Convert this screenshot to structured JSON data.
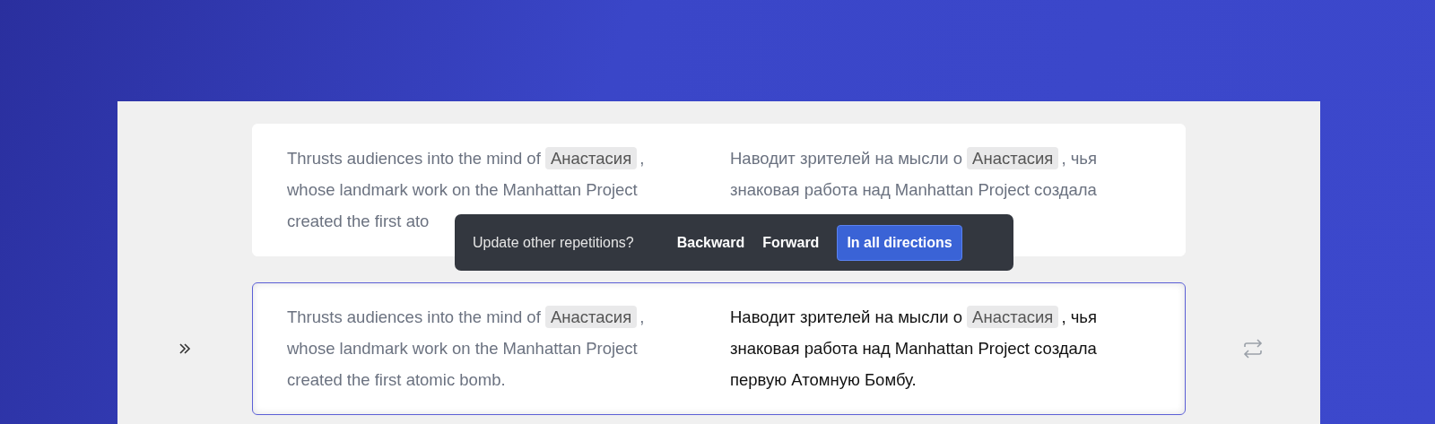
{
  "segments": [
    {
      "current": false,
      "source": [
        [
          {
            "kind": "text",
            "text": "Thrusts audiences into the mind of "
          },
          {
            "kind": "tag",
            "text": "Анастасия"
          },
          {
            "kind": "text",
            "text": ","
          }
        ],
        [
          {
            "kind": "text",
            "text": "whose landmark work on the Manhattan Project"
          }
        ],
        [
          {
            "kind": "text",
            "text": "created the first ato"
          }
        ]
      ],
      "target": [
        [
          {
            "kind": "text",
            "text": "Наводит зрителей на мысли о "
          },
          {
            "kind": "tag",
            "text": "Анастасия"
          },
          {
            "kind": "text",
            "text": ", чья"
          }
        ],
        [
          {
            "kind": "text",
            "text": "знаковая работа над Manhattan Project создала"
          }
        ]
      ]
    },
    {
      "current": true,
      "source": [
        [
          {
            "kind": "text",
            "text": "Thrusts audiences into the mind of "
          },
          {
            "kind": "tag",
            "text": "Анастасия"
          },
          {
            "kind": "text",
            "text": ","
          }
        ],
        [
          {
            "kind": "text",
            "text": "whose landmark work on the Manhattan Project"
          }
        ],
        [
          {
            "kind": "text",
            "text": "created the first atomic bomb."
          }
        ]
      ],
      "target": [
        [
          {
            "kind": "text",
            "text": "Наводит зрителей на мысли о "
          },
          {
            "kind": "tag",
            "text": "Анастасия"
          },
          {
            "kind": "text",
            "text": ", чья"
          }
        ],
        [
          {
            "kind": "text",
            "text": "знаковая работа над Manhattan Project создала"
          }
        ],
        [
          {
            "kind": "text",
            "text": "первую Атомную Бомбу."
          }
        ]
      ]
    }
  ],
  "popup": {
    "question": "Update other repetitions?",
    "buttons": [
      {
        "label": "Backward",
        "primary": false
      },
      {
        "label": "Forward",
        "primary": false
      },
      {
        "label": "In all directions",
        "primary": true
      }
    ]
  }
}
